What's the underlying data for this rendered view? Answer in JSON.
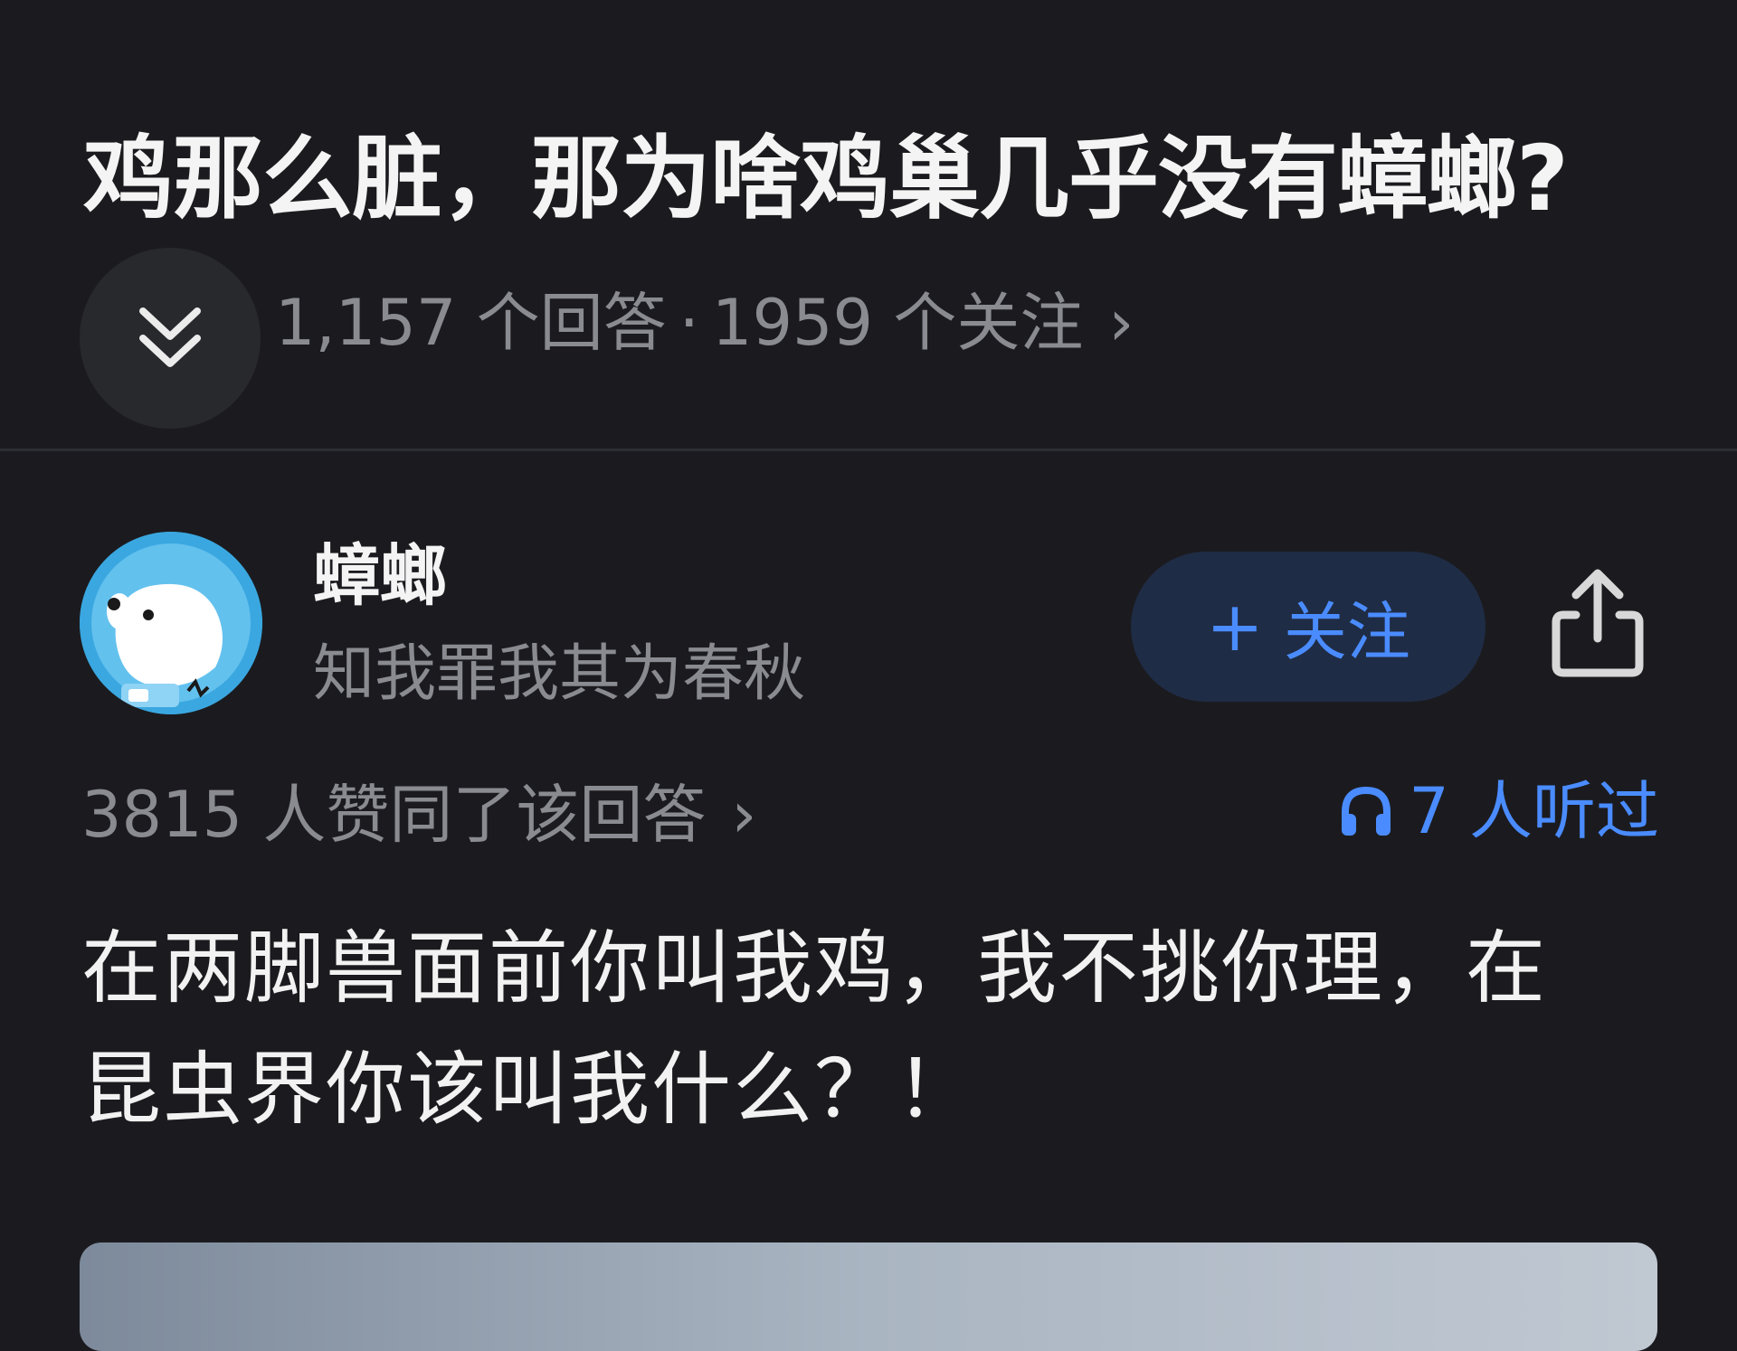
{
  "question": {
    "title": "鸡那么脏，那为啥鸡巢几乎没有蟑螂?",
    "answer_count": "1,157 个回答",
    "separator": "·",
    "follow_count": "1959 个关注",
    "chevron": "›",
    "expand_icon": "double-chevron-down-icon"
  },
  "author": {
    "name": "蟑螂",
    "bio": "知我罪我其为春秋",
    "follow_plus": "+",
    "follow_label": "关注",
    "share_icon": "share-icon",
    "avatar_icon": "cartoon-dog-avatar"
  },
  "stats": {
    "agree_text": "3815 人赞同了该回答",
    "agree_chevron": "›",
    "listen_text": "7 人听过",
    "listen_icon": "headphones-icon"
  },
  "answer": {
    "line1": "在两脚兽面前你叫我鸡，我不挑你理，在",
    "line2": "昆虫界你该叫我什么？！"
  },
  "colors": {
    "background": "#1b1b1f",
    "accent": "#4a8cff",
    "muted_text": "#8a8b90",
    "follow_bg": "#1f2c45"
  }
}
